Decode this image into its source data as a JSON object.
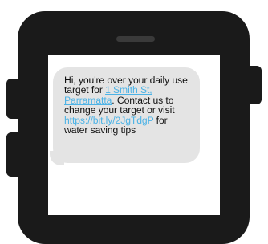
{
  "phone": {
    "icon": "smartphone-icon",
    "body_color": "#1a1a1a"
  },
  "message": {
    "part1": "Hi, you're over your daily use target for ",
    "address": "1 Smith St, Parramatta",
    "part2": ". Contact us to change your target or visit ",
    "url": "https://bit.ly/2JgTdgP",
    "part3": " for water saving tips",
    "bubble_color": "#e4e4e4",
    "link_color": "#4db3e6"
  }
}
